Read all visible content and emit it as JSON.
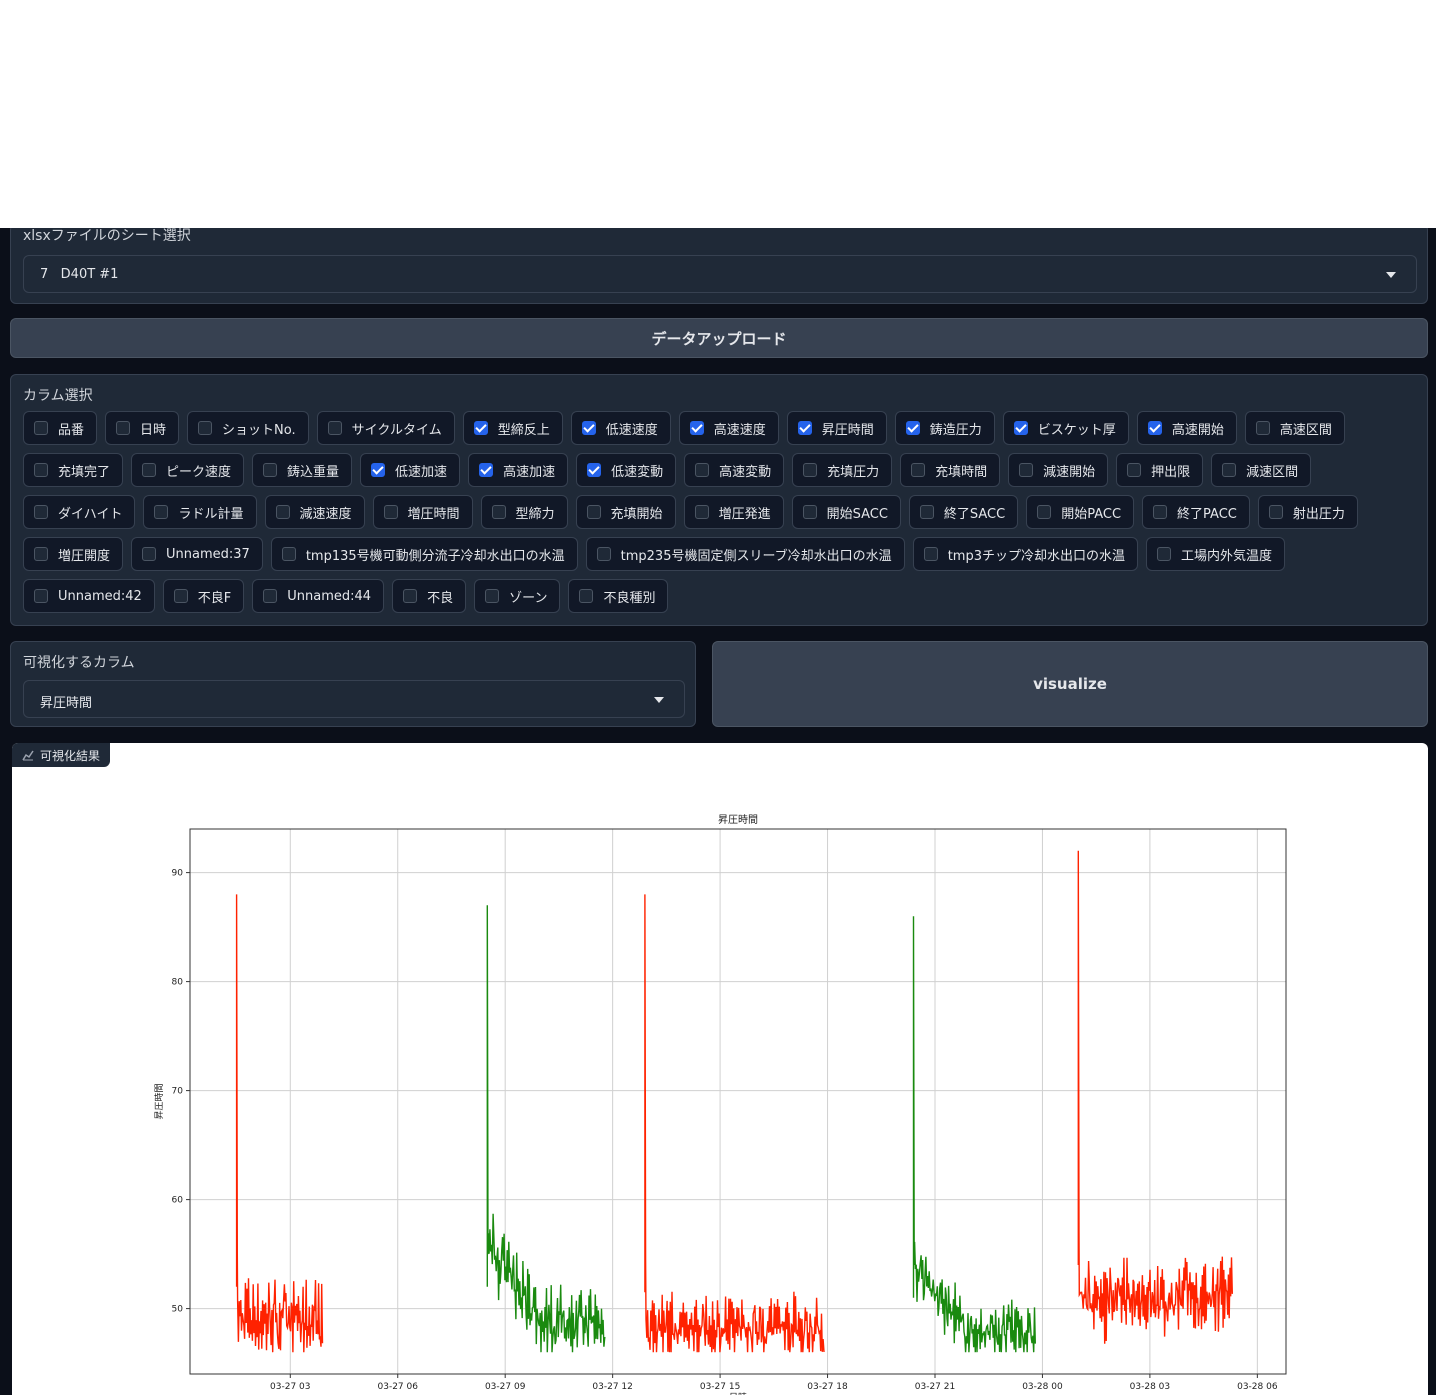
{
  "sheet": {
    "label": "xlsxファイルのシート選択",
    "selected": "7   D40T #1"
  },
  "upload_button": "データアップロード",
  "columns": {
    "label": "カラム選択",
    "items": [
      {
        "label": "品番",
        "checked": false
      },
      {
        "label": "日時",
        "checked": false
      },
      {
        "label": "ショットNo.",
        "checked": false
      },
      {
        "label": "サイクルタイム",
        "checked": false
      },
      {
        "label": "型締反上",
        "checked": true
      },
      {
        "label": "低速速度",
        "checked": true
      },
      {
        "label": "高速速度",
        "checked": true
      },
      {
        "label": "昇圧時間",
        "checked": true
      },
      {
        "label": "鋳造圧力",
        "checked": true
      },
      {
        "label": "ビスケット厚",
        "checked": true
      },
      {
        "label": "高速開始",
        "checked": true
      },
      {
        "label": "高速区間",
        "checked": false
      },
      {
        "label": "充填完了",
        "checked": false
      },
      {
        "label": "ピーク速度",
        "checked": false
      },
      {
        "label": "鋳込重量",
        "checked": false
      },
      {
        "label": "低速加速",
        "checked": true
      },
      {
        "label": "高速加速",
        "checked": true
      },
      {
        "label": "低速変動",
        "checked": true
      },
      {
        "label": "高速変動",
        "checked": false
      },
      {
        "label": "充填圧力",
        "checked": false
      },
      {
        "label": "充填時間",
        "checked": false
      },
      {
        "label": "減速開始",
        "checked": false
      },
      {
        "label": "押出限",
        "checked": false
      },
      {
        "label": "減速区間",
        "checked": false
      },
      {
        "label": "ダイハイト",
        "checked": false
      },
      {
        "label": "ラドル計量",
        "checked": false
      },
      {
        "label": "減速速度",
        "checked": false
      },
      {
        "label": "増圧時間",
        "checked": false
      },
      {
        "label": "型締力",
        "checked": false
      },
      {
        "label": "充填開始",
        "checked": false
      },
      {
        "label": "増圧発進",
        "checked": false
      },
      {
        "label": "開始SACC",
        "checked": false
      },
      {
        "label": "終了SACC",
        "checked": false
      },
      {
        "label": "開始PACC",
        "checked": false
      },
      {
        "label": "終了PACC",
        "checked": false
      },
      {
        "label": "射出圧力",
        "checked": false
      },
      {
        "label": "増圧開度",
        "checked": false
      },
      {
        "label": "Unnamed:37",
        "checked": false
      },
      {
        "label": "tmp135号機可動側分流子冷却水出口の水温",
        "checked": false
      },
      {
        "label": "tmp235号機固定側スリーブ冷却水出口の水温",
        "checked": false
      },
      {
        "label": "tmp3チップ冷却水出口の水温",
        "checked": false
      },
      {
        "label": "工場内外気温度",
        "checked": false
      },
      {
        "label": "Unnamed:42",
        "checked": false
      },
      {
        "label": "不良F",
        "checked": false
      },
      {
        "label": "Unnamed:44",
        "checked": false
      },
      {
        "label": "不良",
        "checked": false
      },
      {
        "label": "ゾーン",
        "checked": false
      },
      {
        "label": "不良種別",
        "checked": false
      }
    ]
  },
  "viz": {
    "label": "可視化するカラム",
    "selected": "昇圧時間",
    "button": "visualize"
  },
  "result_tab": "可視化結果",
  "colors": {
    "red": "#ff2200",
    "green": "#1a8a0f"
  },
  "chart_data": {
    "type": "line",
    "title": "昇圧時間",
    "xlabel": "日時",
    "ylabel": "昇圧時間",
    "x_ticks": [
      "03-27 03",
      "03-27 06",
      "03-27 09",
      "03-27 12",
      "03-27 15",
      "03-27 18",
      "03-27 21",
      "03-28 00",
      "03-28 03",
      "03-28 06"
    ],
    "xlim_hours": [
      -2.8,
      27.8
    ],
    "ylim": [
      44,
      94
    ],
    "y_ticks": [
      50,
      60,
      70,
      80,
      90
    ],
    "grid": true,
    "series": [
      {
        "color": "red",
        "start": -1.5,
        "end": 0.9,
        "peak": 88,
        "base": 50,
        "noise": 4.5,
        "n": 110
      },
      {
        "color": "green",
        "start": 5.5,
        "end": 8.8,
        "peak": 87,
        "base": 50,
        "noise": 4,
        "n": 150,
        "decay": [
          57,
          50
        ]
      },
      {
        "color": "red",
        "start": 9.9,
        "end": 14.9,
        "peak": 88,
        "base": 49.5,
        "noise": 4,
        "n": 220
      },
      {
        "color": "green",
        "start": 17.4,
        "end": 20.8,
        "peak": 86,
        "base": 49,
        "noise": 3.5,
        "n": 150,
        "decay": [
          55,
          49
        ]
      },
      {
        "color": "red",
        "start": 22.0,
        "end": 26.3,
        "peak": 92,
        "base": 52,
        "noise": 4.5,
        "n": 200
      }
    ]
  }
}
